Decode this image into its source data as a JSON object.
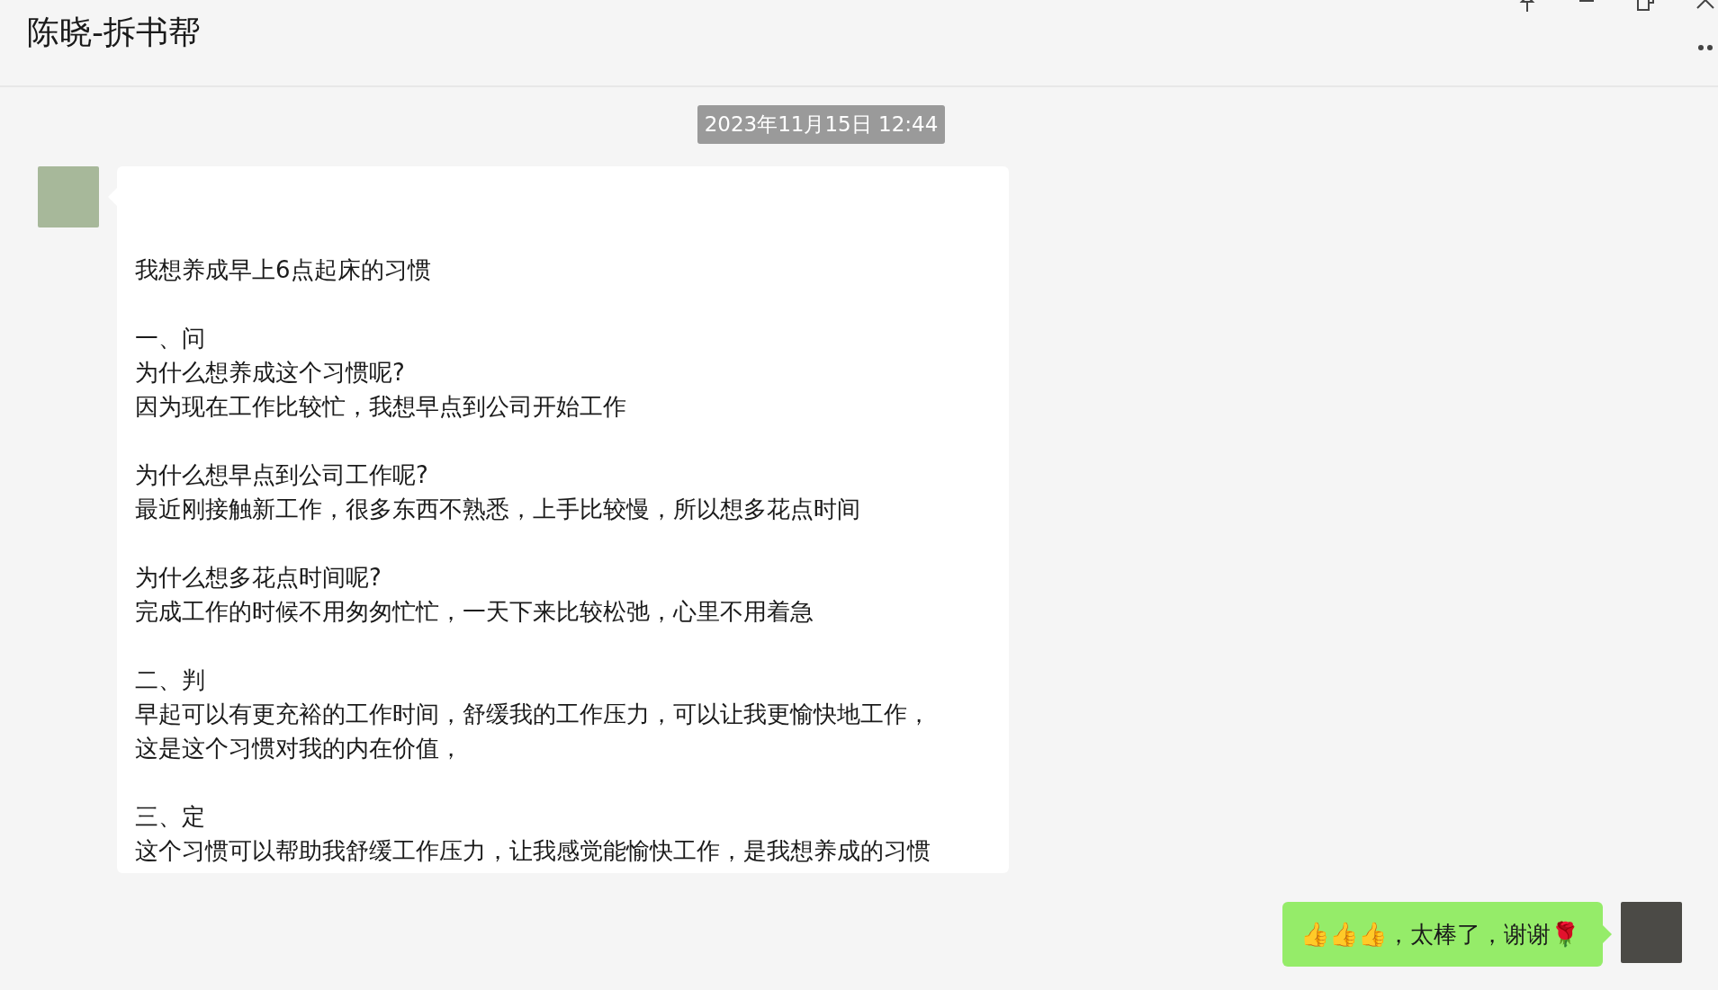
{
  "window": {
    "title": "陈晓-拆书帮"
  },
  "timestamp": "2023年11月15日 12:44",
  "messages": [
    {
      "kind": "received",
      "paragraphs": [
        [
          "我想养成早上6点起床的习惯"
        ],
        [
          "一、问",
          "为什么想养成这个习惯呢?",
          "因为现在工作比较忙，我想早点到公司开始工作"
        ],
        [
          "为什么想早点到公司工作呢?",
          "最近刚接触新工作，很多东西不熟悉，上手比较慢，所以想多花点时间"
        ],
        [
          "为什么想多花点时间呢?",
          "完成工作的时候不用匆匆忙忙，一天下来比较松弛，心里不用着急"
        ],
        [
          "二、判",
          "早起可以有更充裕的工作时间，舒缓我的工作压力，可以让我更愉快地工作，",
          "这是这个习惯对我的内在价值，"
        ],
        [
          "三、定",
          "这个习惯可以帮助我舒缓工作压力，让我感觉能愉快工作，是我想养成的习惯"
        ]
      ]
    },
    {
      "kind": "sent",
      "paragraphs": [
        [
          "👍👍👍，太棒了，谢谢🌹"
        ]
      ]
    }
  ]
}
